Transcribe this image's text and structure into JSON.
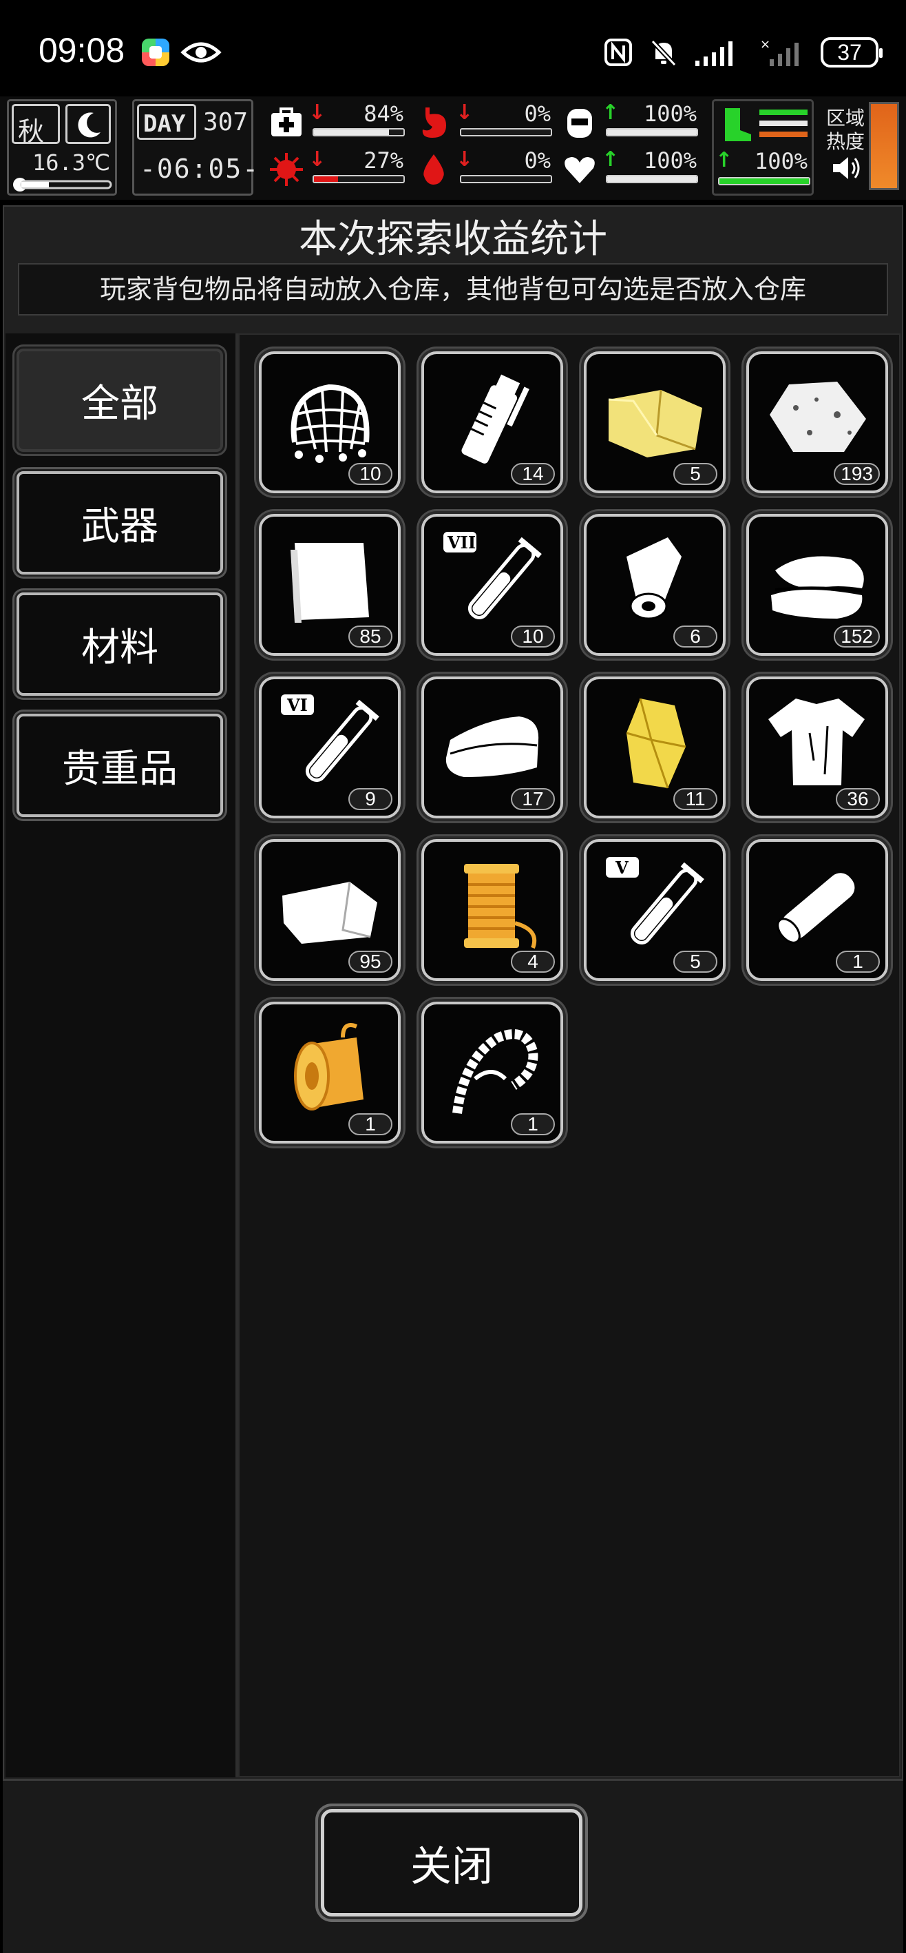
{
  "status_bar": {
    "time": "09:08",
    "battery": "37",
    "icons": [
      "color-app-icon",
      "eye-icon",
      "nfc-icon",
      "mute-bell-icon",
      "signal-icon",
      "no-signal-icon",
      "battery-icon"
    ]
  },
  "hud": {
    "season": "秋",
    "temperature": "16.3℃",
    "day_label": "DAY",
    "day": "307",
    "clock": "-06:05-",
    "stats": [
      {
        "icon": "medkit-icon",
        "trend": "down",
        "value": "84%",
        "level": 0.84
      },
      {
        "icon": "stomach-icon",
        "trend": "down",
        "value": "0%",
        "level": 0
      },
      {
        "icon": "water-tank-icon",
        "trend": "up",
        "value": "100%",
        "level": 1.0
      },
      {
        "icon": "virus-icon",
        "trend": "down",
        "value": "27%",
        "level": 0.27
      },
      {
        "icon": "blood-drop-icon",
        "trend": "down",
        "value": "0%",
        "level": 0
      },
      {
        "icon": "heart-icon",
        "trend": "up",
        "value": "100%",
        "level": 1.0
      },
      {
        "icon": "boot-icon",
        "trend": "up",
        "value": "100%",
        "level": 1.0
      }
    ],
    "zone_label_1": "区域",
    "zone_label_2": "热度",
    "colors": {
      "down": "#e02020",
      "up": "#28d22a",
      "heat": "#e0641a"
    }
  },
  "page": {
    "title": "本次探索收益统计",
    "notice": "玩家背包物品将自动放入仓库，其他背包可勾选是否放入仓库"
  },
  "sidebar": {
    "tabs": [
      {
        "label": "全部",
        "active": true
      },
      {
        "label": "武器",
        "active": false
      },
      {
        "label": "材料",
        "active": false
      },
      {
        "label": "贵重品",
        "active": false
      }
    ]
  },
  "items": [
    {
      "icon": "net-icon",
      "count": "10"
    },
    {
      "icon": "grenade-icon",
      "count": "14"
    },
    {
      "icon": "yellow-cloth-icon",
      "count": "5"
    },
    {
      "icon": "rock-icon",
      "count": "193"
    },
    {
      "icon": "paper-stack-icon",
      "count": "85"
    },
    {
      "icon": "test-tube-vii-icon",
      "count": "10"
    },
    {
      "icon": "roll-icon",
      "count": "6"
    },
    {
      "icon": "folded-cloth-icon",
      "count": "152"
    },
    {
      "icon": "test-tube-vi-icon",
      "count": "9"
    },
    {
      "icon": "fabric-roll-icon",
      "count": "17"
    },
    {
      "icon": "gold-crystal-icon",
      "count": "11"
    },
    {
      "icon": "torn-shirt-icon",
      "count": "36"
    },
    {
      "icon": "cloth-scrap-icon",
      "count": "95"
    },
    {
      "icon": "thread-spool-icon",
      "count": "4"
    },
    {
      "icon": "test-tube-v-icon",
      "count": "5"
    },
    {
      "icon": "leather-roll-icon",
      "count": "1"
    },
    {
      "icon": "gold-spool-icon",
      "count": "1"
    },
    {
      "icon": "bone-whip-icon",
      "count": "1"
    }
  ],
  "footer": {
    "close_label": "关闭"
  }
}
